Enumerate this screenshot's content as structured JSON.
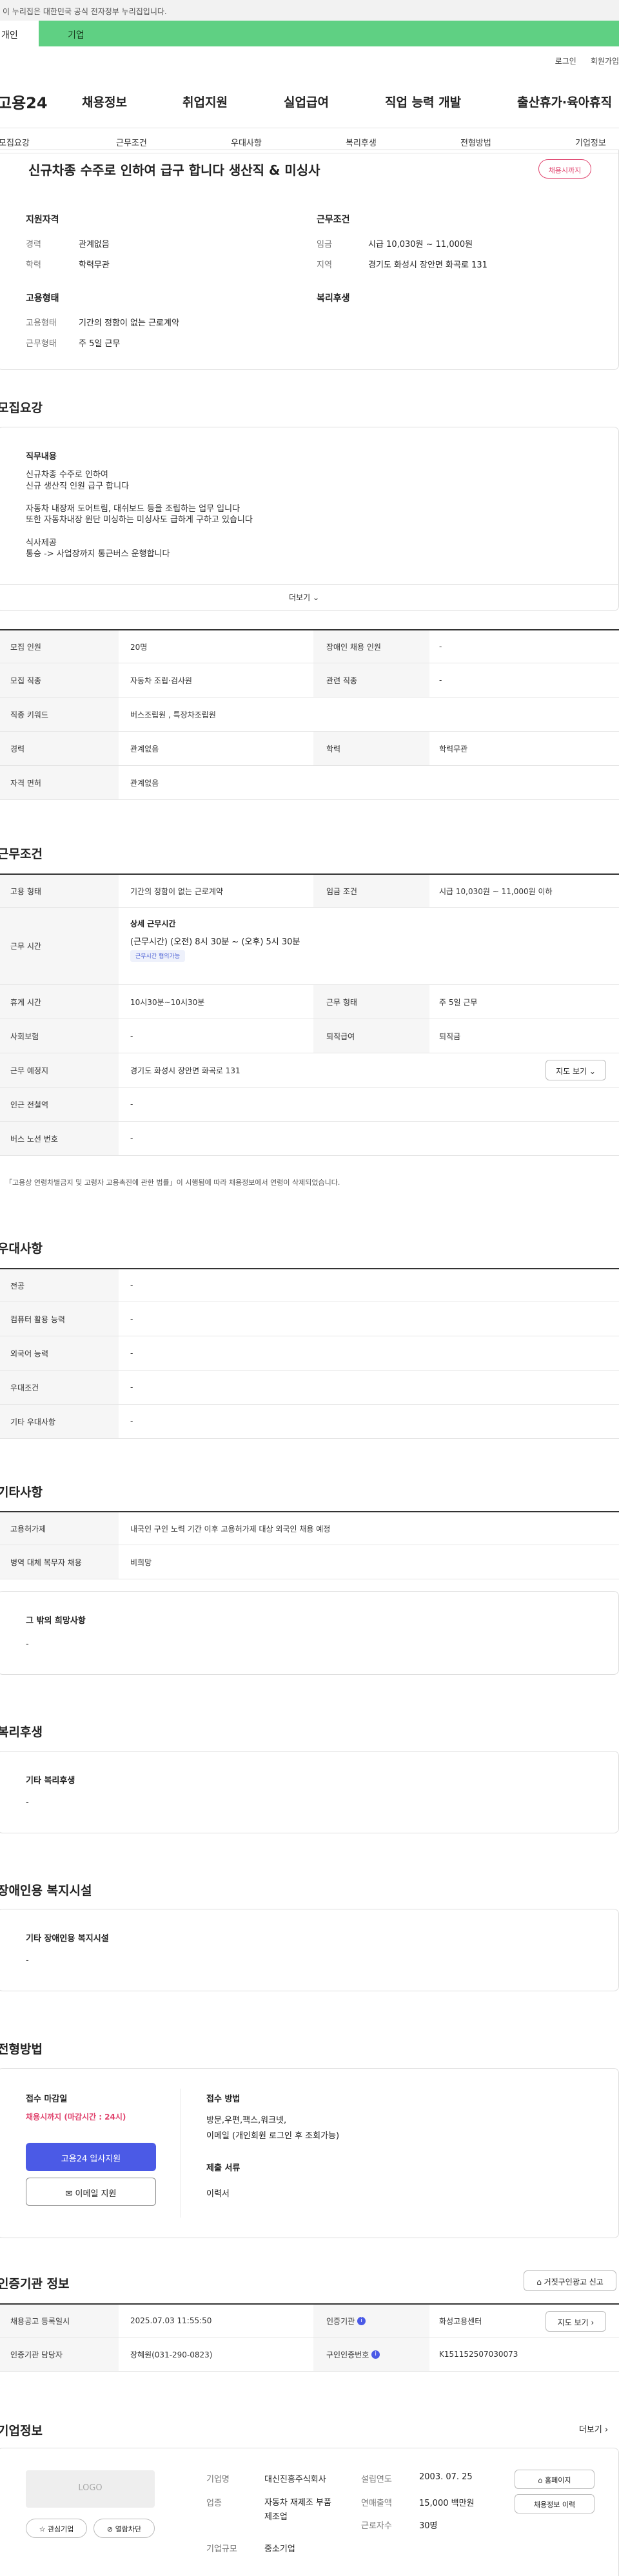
{
  "gov_banner": "이 누리집은 대한민국 공식 전자정부 누리집입니다.",
  "top_tabs": [
    "개인",
    "기업"
  ],
  "util_links": [
    "로그인",
    "회원가입"
  ],
  "logo": "고용24",
  "gnb": [
    "채용정보",
    "취업지원",
    "실업급여",
    "직업 능력 개발",
    "출산휴가·육아휴직"
  ],
  "tabs": [
    "모집요강",
    "근무조건",
    "우대사항",
    "복리후생",
    "전형방법",
    "기업정보"
  ],
  "summary": {
    "title": "신규차종 수주로 인하여 급구 합니다 생산직 & 미싱사",
    "badge": "채용시까지",
    "qual_title": "지원자격",
    "career_label": "경력",
    "career": "관계없음",
    "edu_label": "학력",
    "edu": "학력무관",
    "cond_title": "근무조건",
    "wage_label": "임금",
    "wage": "시급 10,030원 ~ 11,000원",
    "region_label": "지역",
    "region": "경기도 화성시 장안면 화곡로 131",
    "emp_title": "고용형태",
    "emptype_label": "고용형태",
    "emptype": "기간의 정함이 없는 근로계약",
    "worktype_label": "근무형태",
    "worktype": "주 5일 근무",
    "welfare_title": "복리후생"
  },
  "recruit": {
    "heading": "모집요강",
    "duty_title": "직무내용",
    "duty_lines": [
      "신규차종 수주로 인하여",
      "신규 생산직 인원 급구 합니다",
      "",
      "자동차 내장재 도어트림, 대쉬보드 등을 조립하는 업무 입니다",
      "또한 자동차내장 원단 미싱하는 미싱사도 급하게 구하고 있습니다",
      "",
      "식사제공",
      "통승 -> 사업장까지 통근버스 운행합니다"
    ],
    "more": "더보기",
    "rows": [
      {
        "l1": "모집 인원",
        "v1": "20명",
        "l2": "장애인 채용 인원",
        "v2": "-"
      },
      {
        "l1": "모집 직종",
        "v1": "자동차 조립·검사원",
        "l2": "관련 직종",
        "v2": "-"
      },
      {
        "l1": "직종 키워드",
        "v1": "버스조립원 , 특장차조립원"
      },
      {
        "l1": "경력",
        "v1": "관계없음",
        "l2": "학력",
        "v2": "학력무관"
      },
      {
        "l1": "자격 면허",
        "v1": "관계없음"
      }
    ]
  },
  "conditions": {
    "heading": "근무조건",
    "emp_label": "고용 형태",
    "emp": "기간의 정함이 없는 근로계약",
    "wage_label": "임금 조건",
    "wage": "시급 10,030원 ~ 11,000원 이하",
    "time_label": "근무 시간",
    "time_title": "상세 근무시간",
    "time": "(근무시간) (오전) 8시 30분 ~ (오후) 5시 30분",
    "time_tag": "근무시간 협의가능",
    "rest_label": "휴게 시간",
    "rest": "10시30분~10시30분",
    "form_label": "근무 형태",
    "form": "주 5일 근무",
    "ins_label": "사회보험",
    "ins": "-",
    "sev_label": "퇴직급여",
    "sev": "퇴직금",
    "place_label": "근무 예정지",
    "place": "경기도 화성시 장안면 화곡로 131",
    "map": "지도 보기",
    "station_label": "인근 전철역",
    "station": "-",
    "bus_label": "버스 노선 번호",
    "bus": "-",
    "note": "「고용상 연령차별금지 및 고령자 고용촉진에 관한 법률」이 시행됨에 따라 채용정보에서 연령이 삭제되었습니다."
  },
  "pref": {
    "heading": "우대사항",
    "rows": [
      [
        "전공",
        "-"
      ],
      [
        "컴퓨터 활용 능력",
        "-"
      ],
      [
        "외국어 능력",
        "-"
      ],
      [
        "우대조건",
        "-"
      ],
      [
        "기타 우대사항",
        "-"
      ]
    ]
  },
  "etc": {
    "heading": "기타사항",
    "rows": [
      [
        "고용허가제",
        "내국인 구인 노력 기간 이후 고용허가제 대상 외국인 채용 예정"
      ],
      [
        "병역 대체 복무자 채용",
        "비희망"
      ]
    ],
    "other_title": "그 밖의 희망사항",
    "other": "-"
  },
  "welfare": {
    "heading": "복리후생",
    "title": "기타 복리후생",
    "value": "-"
  },
  "disabled": {
    "heading": "장애인용 복지시설",
    "title": "기타 장애인용 복지시설",
    "value": "-"
  },
  "process": {
    "heading": "전형방법",
    "deadline_title": "접수 마감일",
    "deadline": "채용시까지 (마감시간 : 24시)",
    "apply": "고용24 입사지원",
    "email": "이메일 지원",
    "method_title": "접수 방법",
    "method1": "방문,우편,팩스,워크넷,",
    "method2": "이메일 (개인회원 로그인 후 조회가능)",
    "docs_title": "제출 서류",
    "docs": "이력서"
  },
  "agency": {
    "heading": "인증기관 정보",
    "report": "거짓구인광고 신고",
    "reg_label": "채용공고 등록일시",
    "reg": "2025.07.03 11:55:50",
    "org_label": "인증기관",
    "org": "화성고용센터",
    "map": "지도 보기",
    "staff_label": "인증기관 담당자",
    "staff": "장혜원(031-290-0823)",
    "no_label": "구인인증번호",
    "no": "K151152507030073"
  },
  "company": {
    "heading": "기업정보",
    "more": "더보기",
    "logo": "LOGO",
    "fav": "관심기업",
    "block": "열람차단",
    "name_label": "기업명",
    "name": "대신진흥주식회사",
    "ind_label": "업종",
    "ind": "자동차 재제조 부품 제조업",
    "size_label": "기업규모",
    "size": "중소기업",
    "year_label": "설립연도",
    "year": "2003. 07. 25",
    "sales_label": "연매출액",
    "sales": "15,000 백만원",
    "emp_label": "근로자수",
    "emp": "30명",
    "home": "홈페이지",
    "history": "채용정보 이력"
  }
}
